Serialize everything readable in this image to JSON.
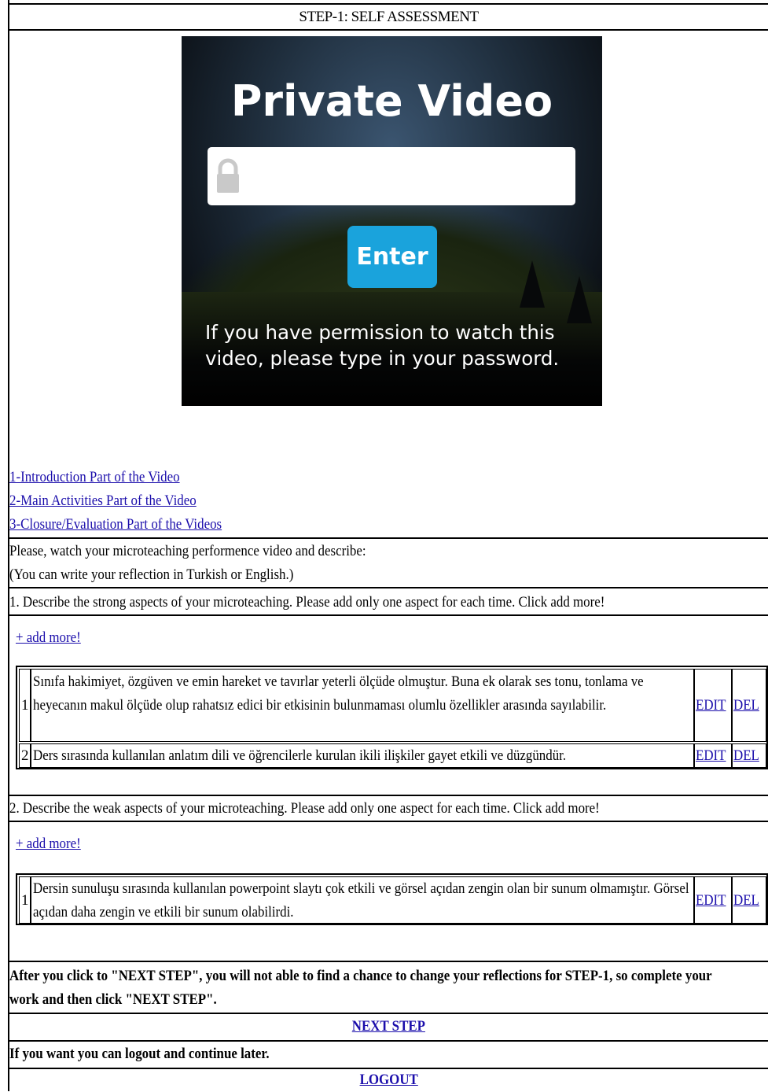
{
  "header": {
    "title": "STEP-1: SELF ASSESSMENT"
  },
  "video": {
    "title": "Private Video",
    "password_placeholder": "",
    "enter_label": "Enter",
    "message": "If you have permission to watch this video, please type in your password.",
    "icons": {
      "lock": "lock-icon"
    },
    "colors": {
      "enter": "#1aa3dc"
    }
  },
  "video_links": [
    "1-Introduction Part of the Video",
    "2-Main Activities Part of the Video",
    "3-Closure/Evaluation Part of the Videos"
  ],
  "instructions": {
    "line1": "Please, watch your microteaching performence video and describe:",
    "line2": "(You can write your reflection in Turkish or English.)"
  },
  "strong": {
    "question": "1. Describe the strong aspects of your microteaching. Please add only one aspect for each time. Click add more!",
    "add_more": "+ add more!",
    "items": [
      {
        "num": "1",
        "text": "Sınıfa hakimiyet, özgüven ve emin hareket ve tavırlar yeterli ölçüde olmuştur. Buna ek olarak ses tonu, tonlama ve heyecanın makul ölçüde olup rahatsız edici bir etkisinin bulunmaması olumlu özellikler arasında sayılabilir.",
        "edit": "EDIT",
        "del": "DEL"
      },
      {
        "num": "2",
        "text": "Ders sırasında kullanılan anlatım dili ve öğrencilerle kurulan ikili ilişkiler gayet etkili ve düzgündür.",
        "edit": "EDIT",
        "del": "DEL"
      }
    ]
  },
  "weak": {
    "question": "2. Describe the weak aspects of your microteaching. Please add only one aspect for each time. Click add more!",
    "add_more": "+ add more!",
    "items": [
      {
        "num": "1",
        "text": "Dersin sunuluşu sırasında kullanılan powerpoint slaytı çok etkili ve görsel açıdan zengin olan bir sunum olmamıştır. Görsel açıdan daha zengin ve etkili bir sunum olabilirdi.",
        "edit": "EDIT",
        "del": "DEL"
      }
    ]
  },
  "footer": {
    "warning": "After you click to \"NEXT STEP\", you will not able to find a chance to change your reflections for STEP-1, so complete your work and then click \"NEXT STEP\".",
    "next_step": "NEXT STEP",
    "logout_note": "If you want you can logout and continue later.",
    "logout": "LOGOUT"
  }
}
